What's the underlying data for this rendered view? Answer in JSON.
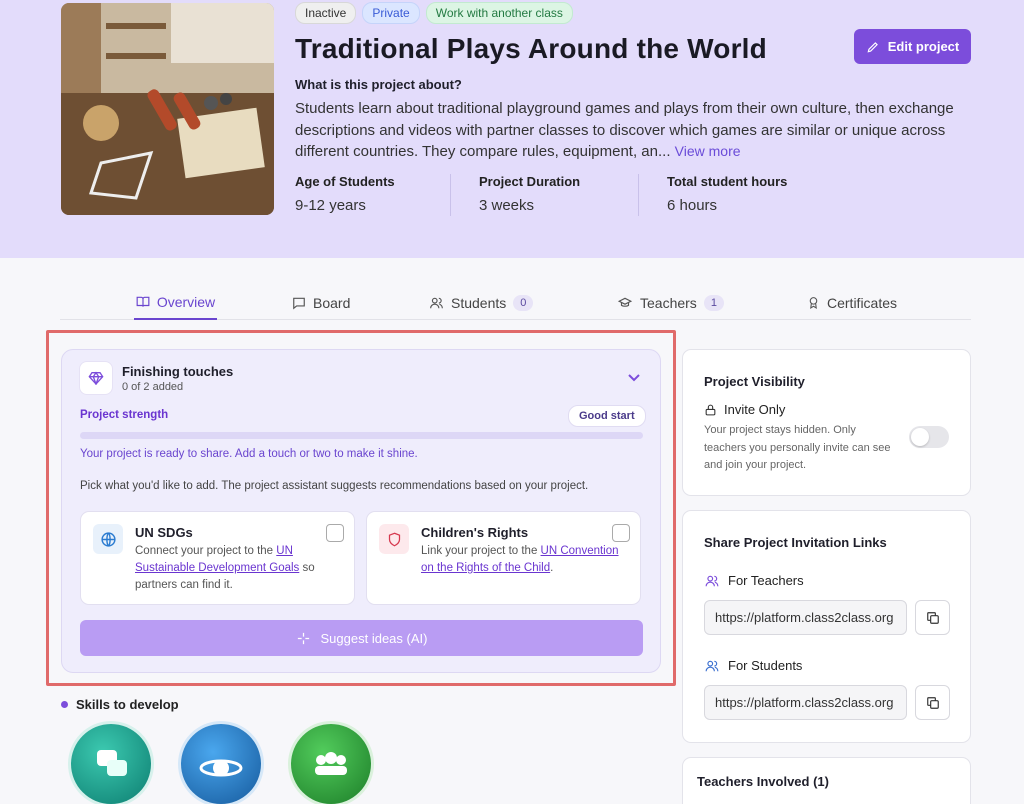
{
  "project": {
    "tags": [
      "Inactive",
      "Private",
      "Work with another class"
    ],
    "title": "Traditional Plays Around the World",
    "edit_label": "Edit project",
    "about_heading": "What is this project about?",
    "description": "Students learn about traditional playground games and plays from their own culture, then exchange descriptions and videos with partner classes to discover which games are similar or unique across different countries. They compare rules, equipment, an...",
    "view_more": "View more",
    "stats": [
      {
        "label": "Age of Students",
        "value": "9-12 years"
      },
      {
        "label": "Project Duration",
        "value": "3 weeks"
      },
      {
        "label": "Total student hours",
        "value": "6 hours"
      }
    ]
  },
  "tabs": [
    {
      "label": "Overview",
      "icon": "book-icon"
    },
    {
      "label": "Board",
      "icon": "chat-icon"
    },
    {
      "label": "Students",
      "icon": "users-icon",
      "count": "0"
    },
    {
      "label": "Teachers",
      "icon": "graduation-cap-icon",
      "count": "1"
    },
    {
      "label": "Certificates",
      "icon": "award-icon"
    }
  ],
  "finishing": {
    "title": "Finishing touches",
    "subtitle": "0 of 2 added",
    "strength_label": "Project strength",
    "strength_badge": "Good start",
    "strength_value": 0,
    "ready_text": "Your project is ready to share. Add a touch or two to make it shine.",
    "pick_text": "Pick what you'd like to add. The project assistant suggests recommendations based on your project.",
    "cards": [
      {
        "title": "UN SDGs",
        "pre": "Connect your project to the ",
        "link": "UN Sustainable Development Goals",
        "post": " so partners can find it.",
        "checked": false
      },
      {
        "title": "Children's Rights",
        "pre": "Link your project to the ",
        "link": "UN Convention on the Rights of the Child",
        "post": ".",
        "checked": false
      }
    ],
    "suggest_label": "Suggest ideas (AI)"
  },
  "skills_heading": "Skills to develop",
  "visibility": {
    "heading": "Project Visibility",
    "mode": "Invite Only",
    "desc": "Your project stays hidden. Only teachers you personally invite can see and join your project.",
    "enabled": false
  },
  "share": {
    "heading": "Share Project Invitation Links",
    "teachers_label": "For Teachers",
    "teachers_link": "https://platform.class2class.org",
    "students_label": "For Students",
    "students_link": "https://platform.class2class.org"
  },
  "teachers_involved": "Teachers Involved (1)",
  "colors": {
    "accent": "#7c4ddb",
    "hero_bg": "#e3dcfb"
  }
}
